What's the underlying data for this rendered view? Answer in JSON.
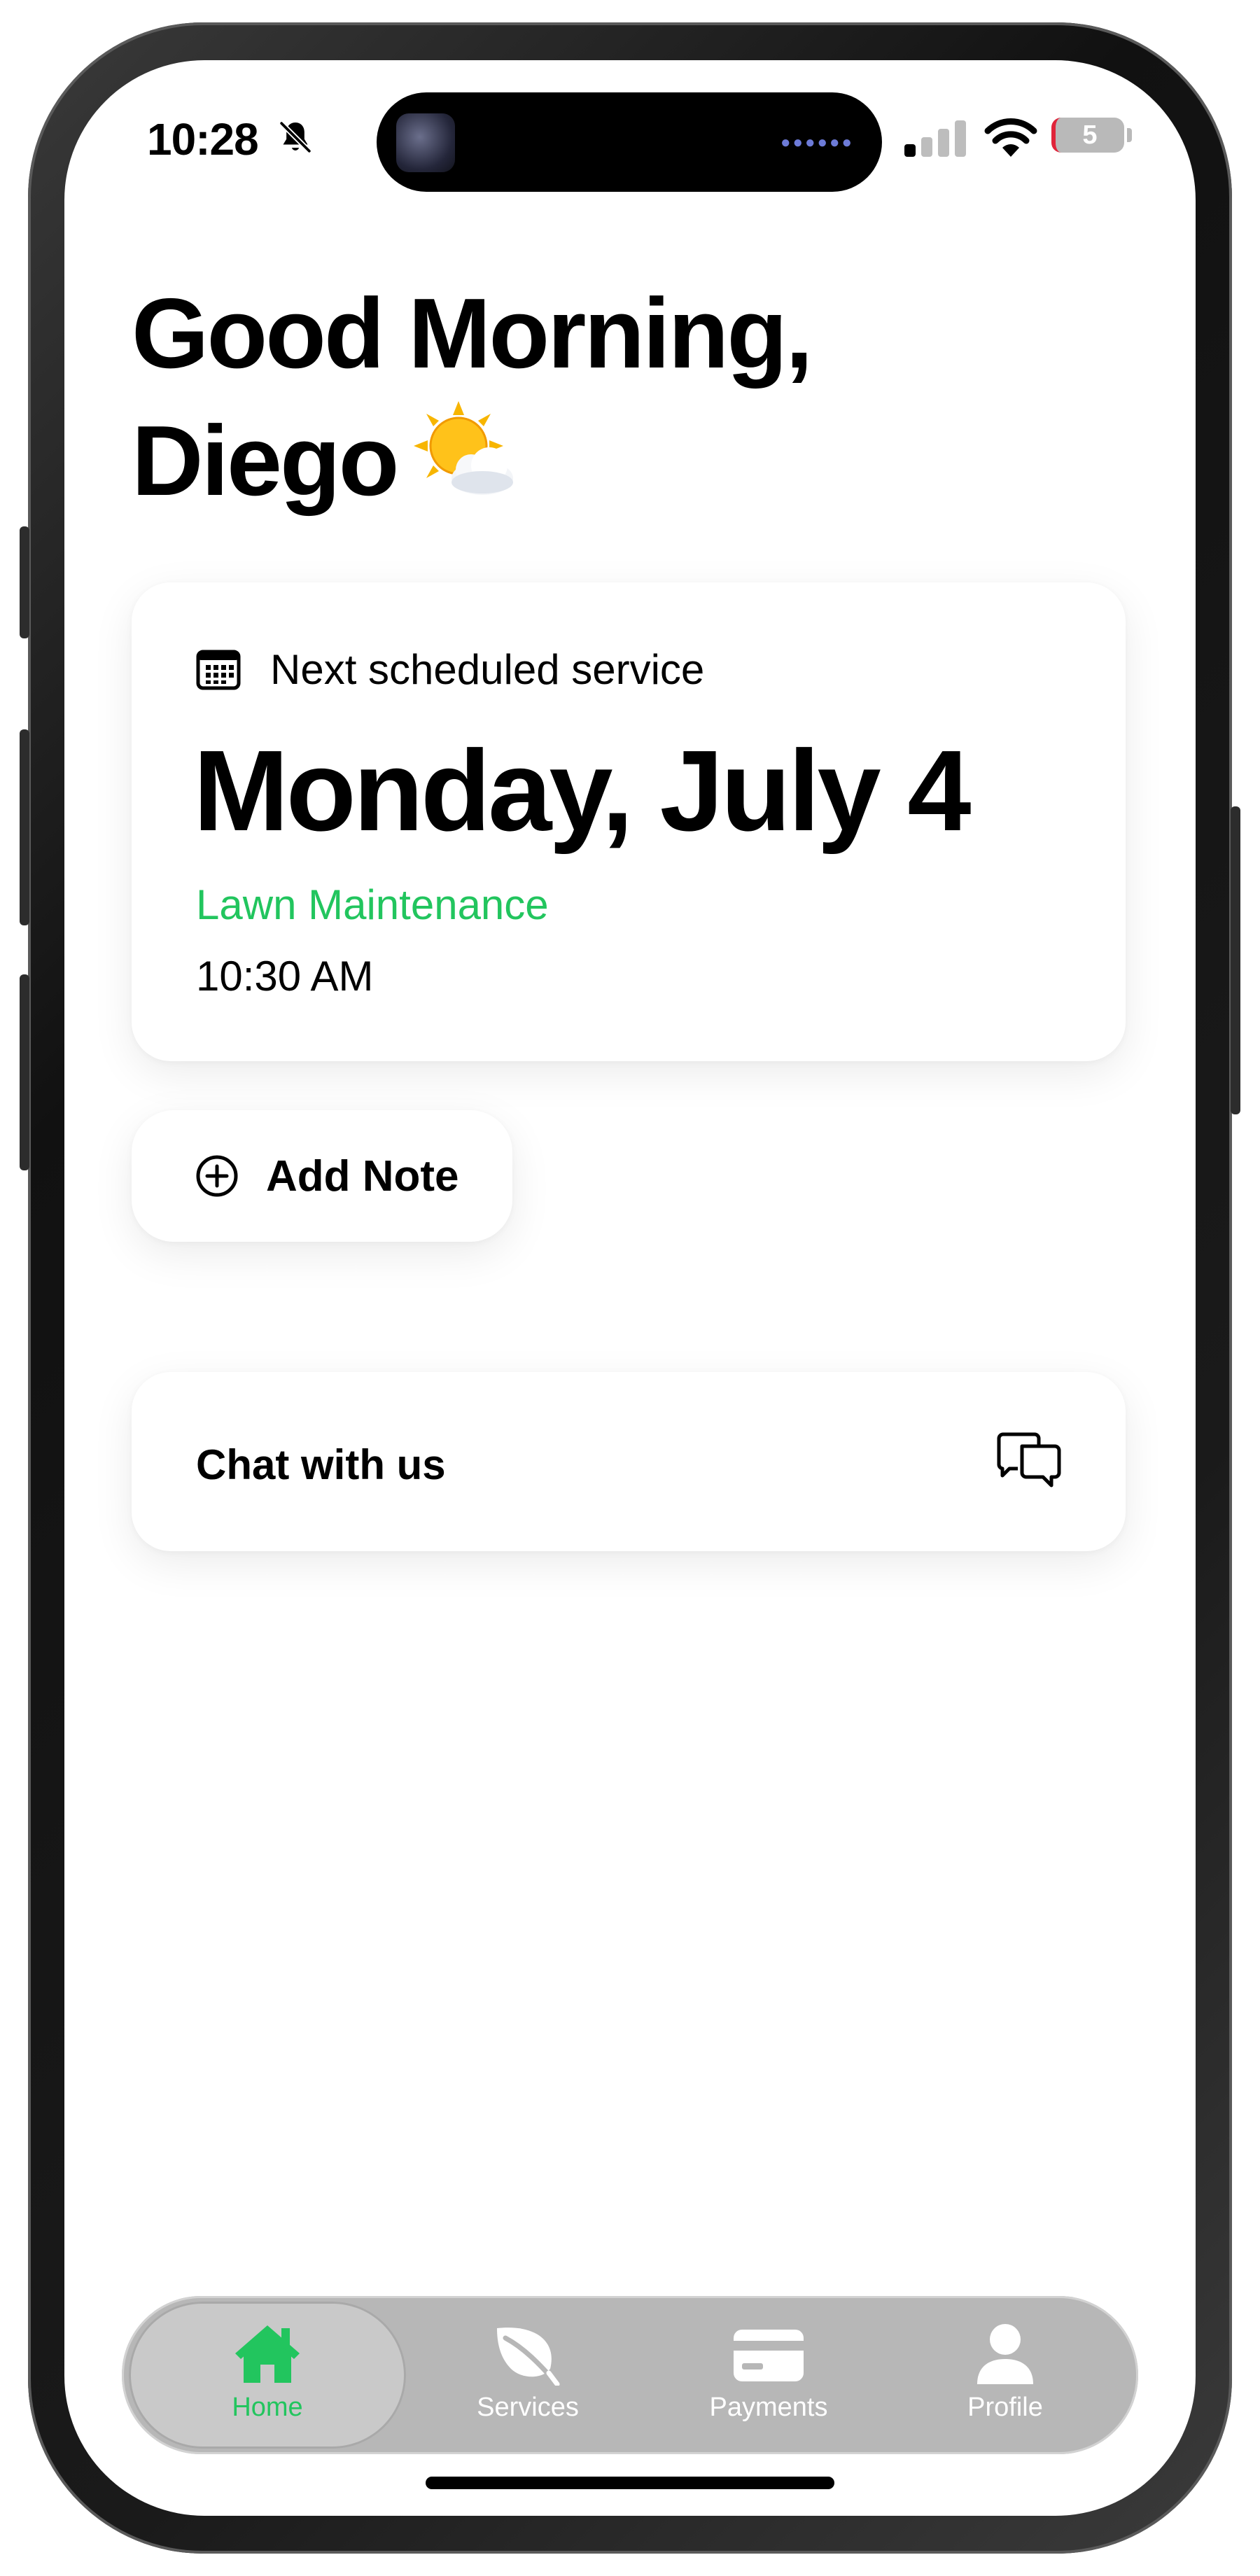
{
  "status_bar": {
    "time": "10:28",
    "battery_level": "5",
    "icons": [
      "bell-slash-icon",
      "signal-icon",
      "wifi-icon",
      "battery-icon"
    ]
  },
  "greeting": {
    "line1": "Good Morning,",
    "line2": "Diego",
    "icon": "sun-behind-cloud-icon"
  },
  "next_service": {
    "header_icon": "calendar-icon",
    "header_label": "Next scheduled service",
    "date": "Monday, July 4",
    "service_type": "Lawn Maintenance",
    "time": "10:30 AM"
  },
  "add_note": {
    "icon": "plus-circle-icon",
    "label": "Add Note"
  },
  "chat": {
    "label": "Chat with us",
    "icon": "chat-bubbles-icon"
  },
  "tab_bar": {
    "active": "Home",
    "items": [
      {
        "label": "Home",
        "icon": "house-icon"
      },
      {
        "label": "Services",
        "icon": "leaf-icon"
      },
      {
        "label": "Payments",
        "icon": "credit-card-icon"
      },
      {
        "label": "Profile",
        "icon": "person-icon"
      }
    ]
  },
  "colors": {
    "accent_green": "#22c55e",
    "tab_bar_bg": "#b7b7b7",
    "battery_red": "#e0243a"
  }
}
